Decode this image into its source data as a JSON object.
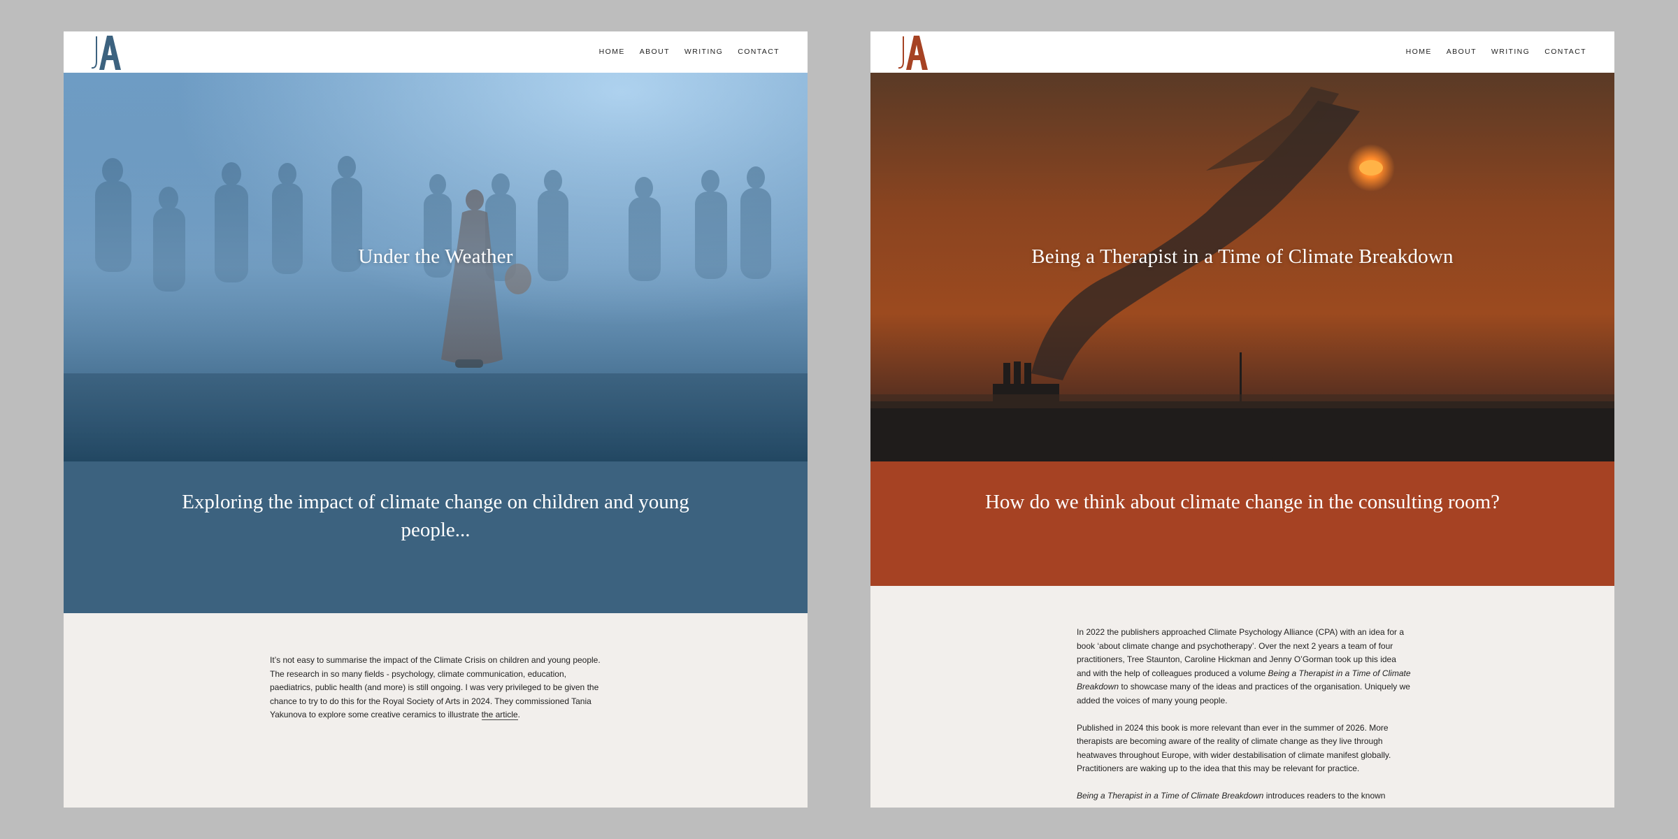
{
  "colors": {
    "page_bg": "#bdbdbd",
    "blue_accent": "#3c627f",
    "rust_accent": "#a64223",
    "content_bg": "#f2efec"
  },
  "logo_text": "JA",
  "nav": [
    "HOME",
    "ABOUT",
    "WRITING",
    "CONTACT"
  ],
  "left": {
    "hero_title": "Under the Weather",
    "band_text": "Exploring the impact of climate change on children and young people...",
    "paragraph_main": "It’s not easy to summarise the impact of the Climate Crisis on children and young people. The research in so many fields - psychology, climate communication, education, paediatrics, public health (and more) is still ongoing. I was very privileged to be given the chance to try to do this for the Royal Society of Arts in 2024. They commissioned Tania Yakunova to explore some creative ceramics to illustrate ",
    "paragraph_link": "the article",
    "paragraph_end": "."
  },
  "right": {
    "hero_title": "Being a Therapist in a Time of Climate Breakdown",
    "band_text": "How do we think about climate change in the consulting room?",
    "p1_a": "In 2022 the publishers approached Climate Psychology Alliance (CPA) with an idea for a book ‘about climate change and psychotherapy’. Over the next 2 years a team of four practitioners, Tree Staunton, Caroline Hickman and Jenny O’Gorman took up this idea and with the help of colleagues produced a volume ",
    "p1_italic": "Being a Therapist in a Time of Climate Breakdown",
    "p1_b": " to showcase many of the ideas and practices of the organisation. Uniquely we added the voices of many young people.",
    "p2": "Published in 2024 this book is more relevant than ever in the summer of 2026. More therapists are becoming aware of the reality of climate change as they live through heatwaves throughout Europe, with wider destabilisation of climate manifest globally. Practitioners are waking up to the idea that this may be relevant for practice.",
    "p3_italic": "Being a Therapist in a Time of Climate Breakdown",
    "p3_b": " introduces readers to the known"
  }
}
